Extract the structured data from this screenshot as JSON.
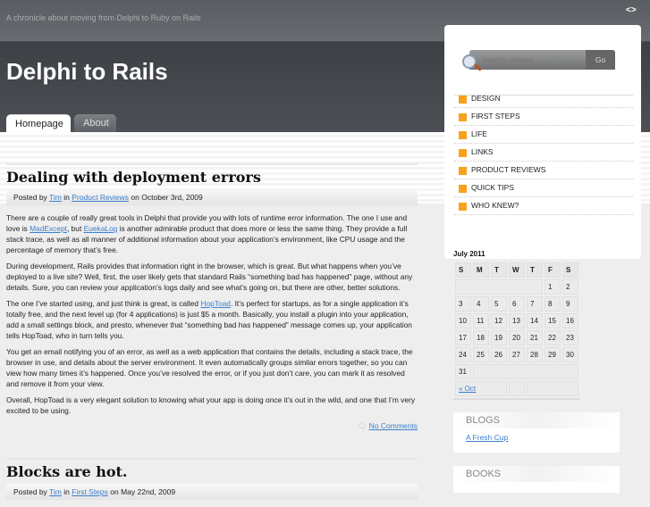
{
  "site": {
    "tagline": "A chronicle about moving from Delphi to Ruby on Rails",
    "title": "Delphi to Rails",
    "arrows": "<>"
  },
  "nav": {
    "tabs": [
      {
        "label": "Homepage"
      },
      {
        "label": "About"
      }
    ]
  },
  "posts": [
    {
      "title": "Dealing with deployment errors",
      "meta": {
        "posted_by": "Posted by",
        "author": "Tim",
        "in": "in",
        "category": "Product Reviews",
        "on": "on October 3rd, 2009"
      },
      "paragraphs": [
        {
          "before": "There are a couple of really great tools in Delphi that provide you with lots of runtime error information. The one I use and love is ",
          "link1": "MadExcept",
          "mid": ", but ",
          "link2": "EuekaLog",
          "after": " is another admirable product that does more or less the same thing. They provide a full stack trace, as well as all manner of additional information about your application’s environment, like CPU usage and the percentage of memory that’s free."
        },
        {
          "text": "During development, Rails provides that information right in the browser, which is great. But what happens when you’ve deployed to a live site? Well, first, the user likely gets that standard Rails “something bad has happened” page, without any details. Sure, you can review your application’s logs daily and see what’s going on, but there are other, better solutions."
        },
        {
          "before": "The one I’ve started using, and just think is great, is called ",
          "link1": "HopToad",
          "after": ". It’s perfect for startups, as for a single application it’s totally free, and the next level up (for 4 applications) is just $5 a month. Basically, you install a plugin into your application, add a small settings block, and presto, whenever that “something bad has happened” message comes up, your application tells HopToad, who in turn tells you."
        },
        {
          "text": "You get an email notifying you of an error, as well as a web application that contains the details, including a stack trace, the browser in use, and details about the server environment. It even automatically groups similar errors together, so you can view how many times it’s happened. Once you’ve resolved the error, or if you just don’t care, you can mark it as resolved and remove it from your view."
        },
        {
          "text": "Overall, HopToad is a very elegant solution to knowing what your app is doing once it’s out in the wild, and one that I’m very excited to be using."
        }
      ],
      "comments": "No Comments"
    },
    {
      "title": "Blocks are hot.",
      "meta": {
        "posted_by": "Posted by",
        "author": "Tim",
        "in": "in",
        "category": "First Steps",
        "on": "on May 22nd, 2009"
      }
    }
  ],
  "sidebar": {
    "search": {
      "placeholder": "Search website...",
      "go": "Go"
    },
    "categories": [
      "DESIGN",
      "FIRST STEPS",
      "LIFE",
      "LINKS",
      "PRODUCT REVIEWS",
      "QUICK TIPS",
      "WHO KNEW?"
    ],
    "calendar": {
      "caption": "July 2011",
      "days": [
        "S",
        "M",
        "T",
        "W",
        "T",
        "F",
        "S"
      ],
      "prev": "« Oct",
      "weeks": [
        [
          "",
          "",
          "",
          "",
          "",
          "1",
          "2"
        ],
        [
          "3",
          "4",
          "5",
          "6",
          "7",
          "8",
          "9"
        ],
        [
          "10",
          "11",
          "12",
          "13",
          "14",
          "15",
          "16"
        ],
        [
          "17",
          "18",
          "19",
          "20",
          "21",
          "22",
          "23"
        ],
        [
          "24",
          "25",
          "26",
          "27",
          "28",
          "29",
          "30"
        ],
        [
          "31"
        ]
      ]
    },
    "blogs": {
      "title": "BLOGS",
      "link": "A Fresh Cup"
    },
    "books": {
      "title": "BOOKS"
    }
  },
  "colors": {
    "accent": "#f7a11c",
    "link": "#3b7fcf"
  }
}
